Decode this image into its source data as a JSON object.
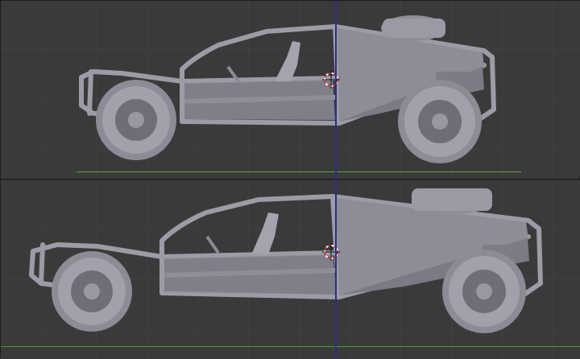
{
  "app": {
    "view": "3D viewport",
    "viewports": [
      {
        "name": "top-viewport",
        "object": "dune-buggy-model"
      },
      {
        "name": "bottom-viewport",
        "object": "dune-buggy-model"
      }
    ]
  },
  "colors": {
    "background": "#3a3a3a",
    "grid": "#404040",
    "ground_axis": "#5aa83a",
    "z_axis": "#2c2c8a",
    "model": "#9a9aa4",
    "model_shadow": "#6f6f78",
    "cursor_red": "#e0262a",
    "cursor_white": "#ffffff"
  },
  "icons": {
    "cursor": "3d-cursor-icon"
  }
}
